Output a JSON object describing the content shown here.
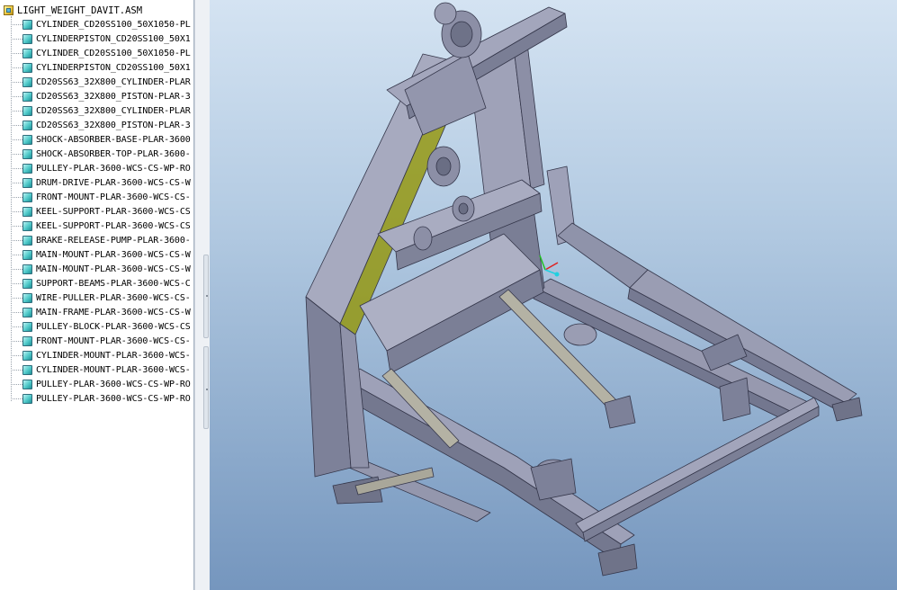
{
  "model_tree": {
    "root": {
      "label": "LIGHT_WEIGHT_DAVIT.ASM",
      "icon": "assembly-icon"
    },
    "items": [
      {
        "label": "CYLINDER_CD20SS100_50X1050-PL",
        "icon": "part-icon"
      },
      {
        "label": "CYLINDERPISTON_CD20SS100_50X1",
        "icon": "part-icon"
      },
      {
        "label": "CYLINDER_CD20SS100_50X1050-PL",
        "icon": "part-icon"
      },
      {
        "label": "CYLINDERPISTON_CD20SS100_50X1",
        "icon": "part-icon"
      },
      {
        "label": "CD20SS63_32X800_CYLINDER-PLAR",
        "icon": "part-icon"
      },
      {
        "label": "CD20SS63_32X800_PISTON-PLAR-3",
        "icon": "part-icon"
      },
      {
        "label": "CD20SS63_32X800_CYLINDER-PLAR",
        "icon": "part-icon"
      },
      {
        "label": "CD20SS63_32X800_PISTON-PLAR-3",
        "icon": "part-icon"
      },
      {
        "label": "SHOCK-ABSORBER-BASE-PLAR-3600",
        "icon": "part-icon"
      },
      {
        "label": "SHOCK-ABSORBER-TOP-PLAR-3600-",
        "icon": "part-icon"
      },
      {
        "label": "PULLEY-PLAR-3600-WCS-CS-WP-RO",
        "icon": "part-icon"
      },
      {
        "label": "DRUM-DRIVE-PLAR-3600-WCS-CS-W",
        "icon": "part-icon"
      },
      {
        "label": "FRONT-MOUNT-PLAR-3600-WCS-CS-",
        "icon": "part-icon"
      },
      {
        "label": "KEEL-SUPPORT-PLAR-3600-WCS-CS",
        "icon": "part-icon"
      },
      {
        "label": "KEEL-SUPPORT-PLAR-3600-WCS-CS",
        "icon": "part-icon"
      },
      {
        "label": "BRAKE-RELEASE-PUMP-PLAR-3600-",
        "icon": "part-icon"
      },
      {
        "label": "MAIN-MOUNT-PLAR-3600-WCS-CS-W",
        "icon": "part-icon"
      },
      {
        "label": "MAIN-MOUNT-PLAR-3600-WCS-CS-W",
        "icon": "part-icon"
      },
      {
        "label": "SUPPORT-BEAMS-PLAR-3600-WCS-C",
        "icon": "part-icon"
      },
      {
        "label": "WIRE-PULLER-PLAR-3600-WCS-CS-",
        "icon": "part-icon"
      },
      {
        "label": "MAIN-FRAME-PLAR-3600-WCS-CS-W",
        "icon": "part-icon"
      },
      {
        "label": "PULLEY-BLOCK-PLAR-3600-WCS-CS",
        "icon": "part-icon"
      },
      {
        "label": "FRONT-MOUNT-PLAR-3600-WCS-CS-",
        "icon": "part-icon"
      },
      {
        "label": "CYLINDER-MOUNT-PLAR-3600-WCS-",
        "icon": "part-icon"
      },
      {
        "label": "CYLINDER-MOUNT-PLAR-3600-WCS-",
        "icon": "part-icon"
      },
      {
        "label": "PULLEY-PLAR-3600-WCS-CS-WP-RO",
        "icon": "part-icon"
      },
      {
        "label": "PULLEY-PLAR-3600-WCS-CS-WP-RO",
        "icon": "part-icon"
      }
    ]
  },
  "viewport": {
    "content": "3D model render of davit assembly",
    "background_top": "#d4e3f2",
    "background_bottom": "#7596be",
    "model_color": "#8c8fa6",
    "model_edge_color": "#34364a"
  },
  "csys_triad": {
    "x_color": "#e02020",
    "y_color": "#20c020",
    "z_color": "#20d0e0"
  }
}
